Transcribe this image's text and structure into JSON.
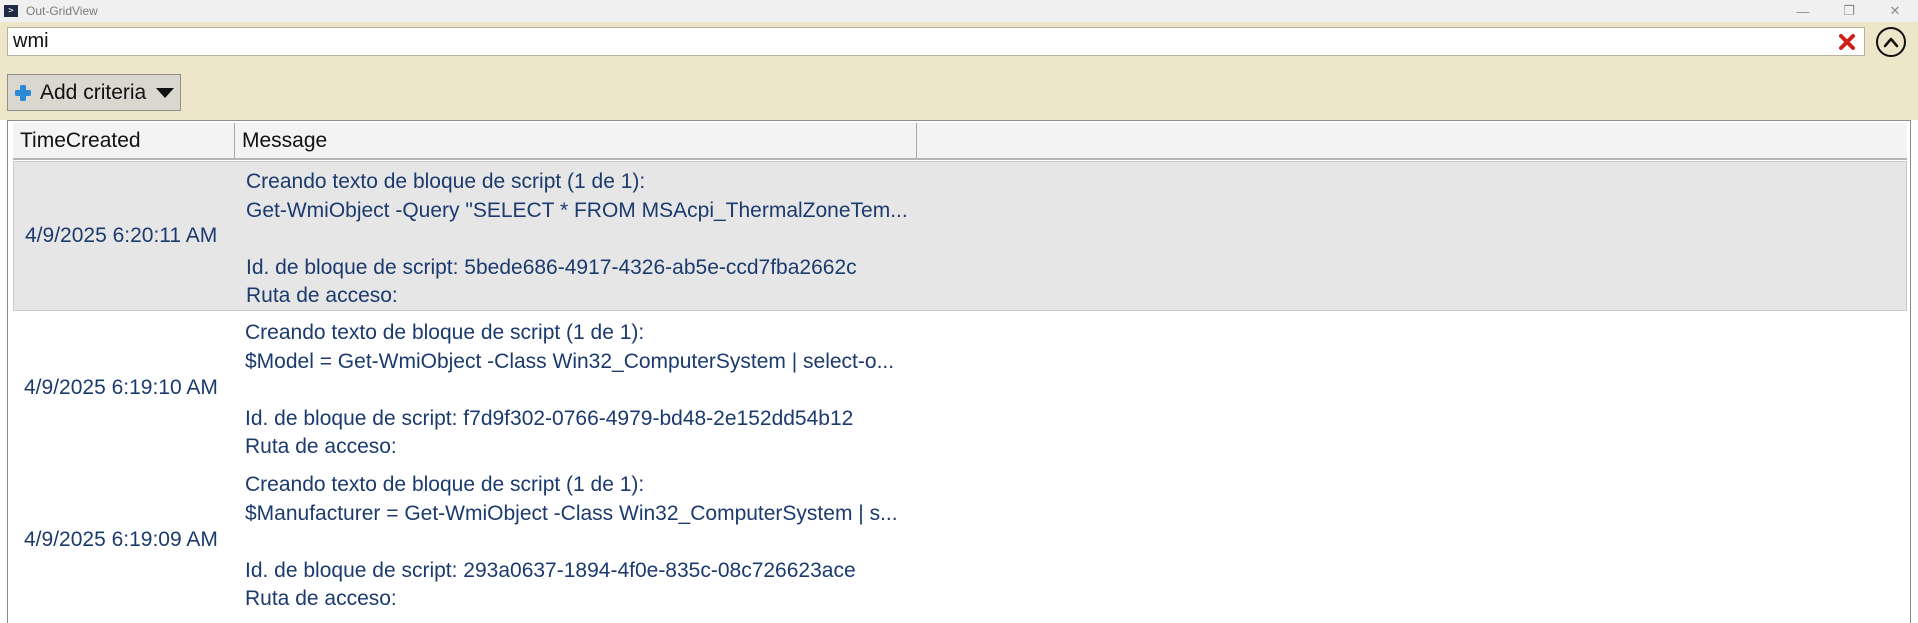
{
  "window": {
    "title": "Out-GridView",
    "controls": {
      "minimize": "—",
      "maximize": "❐",
      "close": "✕"
    }
  },
  "filter": {
    "search_value": "wmi",
    "clear_icon": "red-x-icon",
    "collapse_icon": "chevron-up-icon",
    "add_criteria_label": "Add criteria"
  },
  "grid": {
    "columns": [
      "TimeCreated",
      "Message"
    ],
    "rows": [
      {
        "time": "4/9/2025 6:20:11 AM",
        "selected": true,
        "message": [
          "Creando texto de bloque de script (1 de 1):",
          "Get-WmiObject -Query \"SELECT * FROM MSAcpi_ThermalZoneTem...",
          "",
          "Id. de bloque de script: 5bede686-4917-4326-ab5e-ccd7fba2662c",
          "Ruta de acceso:"
        ]
      },
      {
        "time": "4/9/2025 6:19:10 AM",
        "selected": false,
        "message": [
          "Creando texto de bloque de script (1 de 1):",
          "$Model = Get-WmiObject -Class Win32_ComputerSystem | select-o...",
          "",
          "Id. de bloque de script: f7d9f302-0766-4979-bd48-2e152dd54b12",
          "Ruta de acceso:"
        ]
      },
      {
        "time": "4/9/2025 6:19:09 AM",
        "selected": false,
        "message": [
          "Creando texto de bloque de script (1 de 1):",
          "$Manufacturer = Get-WmiObject -Class Win32_ComputerSystem | s...",
          "",
          "Id. de bloque de script: 293a0637-1894-4f0e-835c-08c726623ace",
          "Ruta de acceso:"
        ]
      }
    ]
  },
  "colors": {
    "filter_background": "#ede6c8",
    "text_blue": "#1b3a6e",
    "selected_row": "#e6e6e6",
    "clear_red": "#d0201a",
    "add_icon_blue": "#2b8ad8"
  }
}
